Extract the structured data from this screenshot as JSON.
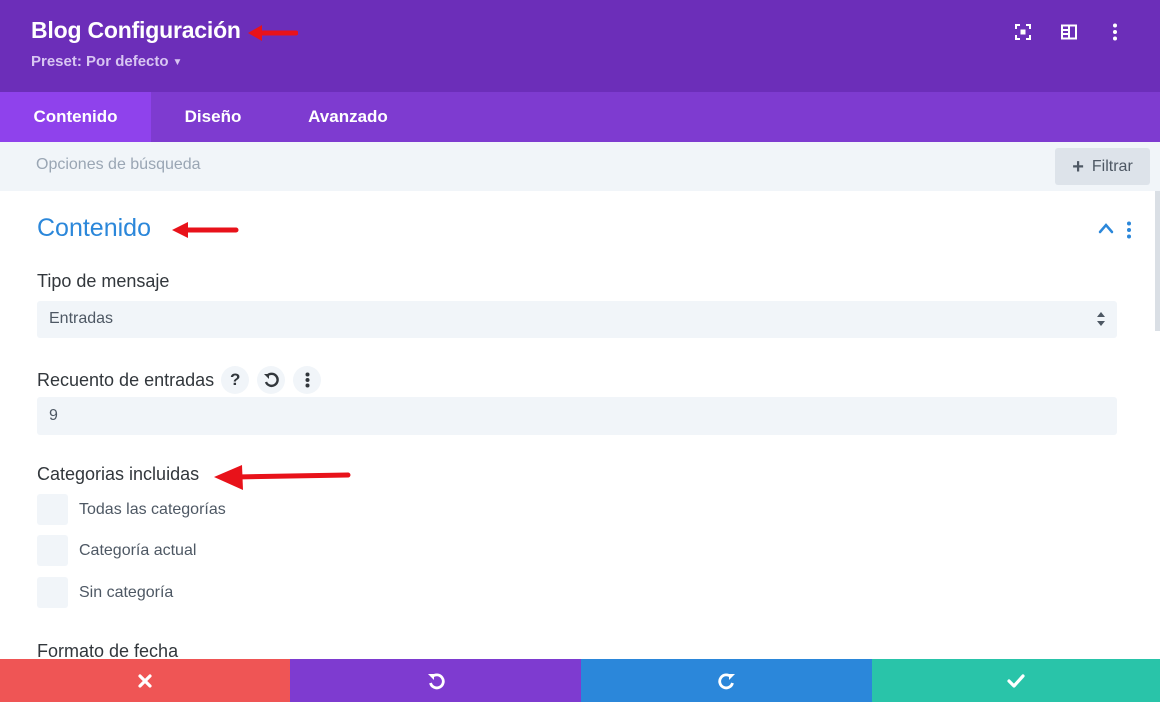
{
  "header": {
    "title": "Blog Configuración",
    "preset_label": "Preset: Por defecto",
    "icons": [
      "focus-icon",
      "split-view-icon",
      "more-vertical-icon"
    ]
  },
  "tabs": [
    {
      "label": "Contenido",
      "active": true
    },
    {
      "label": "Diseño",
      "active": false
    },
    {
      "label": "Avanzado",
      "active": false
    }
  ],
  "search": {
    "placeholder": "Opciones de búsqueda",
    "filter_label": "Filtrar"
  },
  "section": {
    "title": "Contenido",
    "fields": {
      "post_type": {
        "label": "Tipo de mensaje",
        "value": "Entradas"
      },
      "post_count": {
        "label": "Recuento de entradas",
        "value": "9"
      },
      "categories": {
        "label": "Categorias incluidas",
        "options": [
          {
            "label": "Todas las categorías",
            "checked": false
          },
          {
            "label": "Categoría actual",
            "checked": false
          },
          {
            "label": "Sin categoría",
            "checked": false
          }
        ]
      },
      "date_format": {
        "label": "Formato de fecha"
      }
    }
  },
  "colors": {
    "header_bg": "#6c2eb9",
    "tabs_bg": "#7e3bd0",
    "tab_active_bg": "#8f42ec",
    "accent_blue": "#2b87da",
    "annotation_red": "#e8121a",
    "close_red": "#ef5555",
    "save_green": "#29c4a9"
  },
  "actions": [
    "close-icon",
    "undo-icon",
    "redo-icon",
    "check-icon"
  ]
}
